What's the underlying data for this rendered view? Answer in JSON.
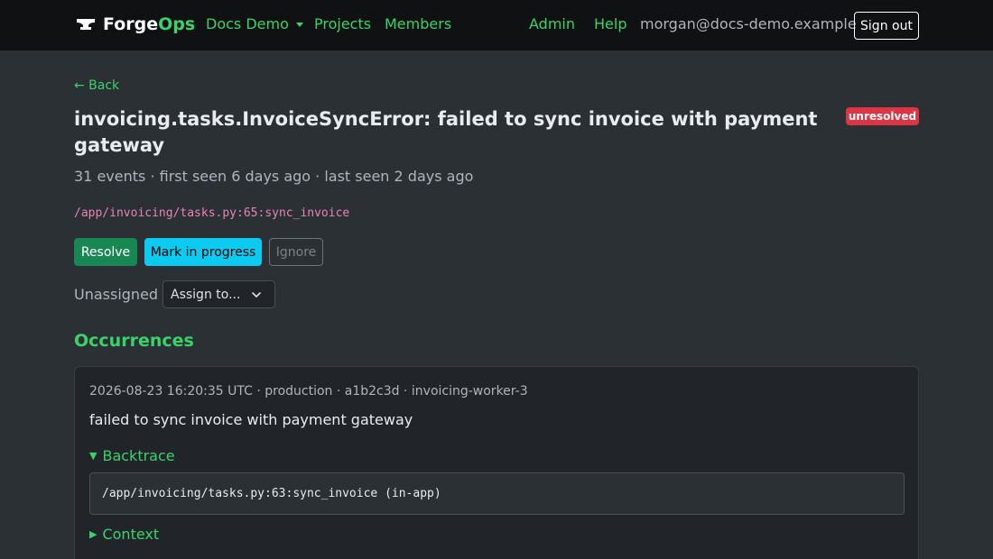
{
  "navbar": {
    "brand_prefix": "Forge",
    "brand_suffix": "Ops",
    "org_label": "Docs Demo",
    "projects_label": "Projects",
    "members_label": "Members",
    "admin_label": "Admin",
    "help_label": "Help",
    "user_email": "morgan@docs-demo.example",
    "signout_label": "Sign out"
  },
  "issue": {
    "back_label": "← Back",
    "title": "invoicing.tasks.InvoiceSyncError: failed to sync invoice with payment gateway",
    "status_badge": "unresolved",
    "meta": "31 events · first seen 6 days ago · last seen 2 days ago",
    "location": "/app/invoicing/tasks.py:65:sync_invoice",
    "actions": {
      "resolve_label": "Resolve",
      "in_progress_label": "Mark in progress",
      "ignore_label": "Ignore"
    },
    "assignee_label": "Unassigned",
    "assign_select_label": "Assign to..."
  },
  "occurrences": {
    "title": "Occurrences",
    "items": [
      {
        "meta": "2026-08-23 16:20:35 UTC · production · a1b2c3d · invoicing-worker-3",
        "message": "failed to sync invoice with payment gateway",
        "backtrace_label": "Backtrace",
        "backtrace_line": "/app/invoicing/tasks.py:63:sync_invoice (in-app)",
        "context_label": "Context"
      }
    ]
  },
  "colors": {
    "accent": "#39d36b",
    "danger": "#dc3545",
    "success": "#198754",
    "info": "#0dcaf0",
    "background": "#2b3035",
    "navbar": "#101112"
  }
}
